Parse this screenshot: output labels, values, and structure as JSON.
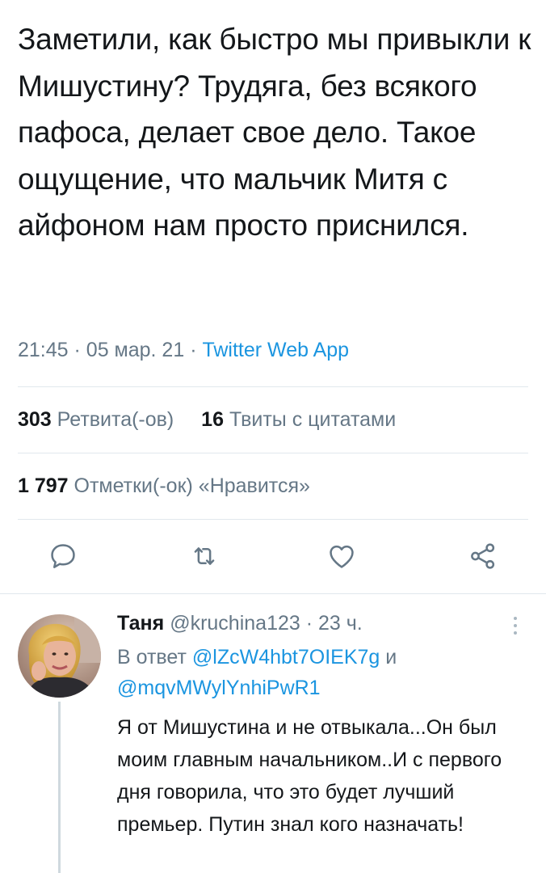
{
  "tweet": {
    "text": "Заметили, как быстро мы привыкли к Мишустину? Трудяга, без всякого пафоса, делает свое дело. Такое ощущение, что мальчик Митя с айфоном нам просто приснился.",
    "time": "21:45",
    "date": "05 мар. 21",
    "separator": "·",
    "source": "Twitter Web App"
  },
  "stats": {
    "retweets_count": "303",
    "retweets_label": "Ретвита(-ов)",
    "quotes_count": "16",
    "quotes_label": "Твиты с цитатами",
    "likes_count": "1 797",
    "likes_label": "Отметки(-ок) «Нравится»"
  },
  "actions": [
    "reply-icon",
    "retweet-icon",
    "heart-icon",
    "share-icon"
  ],
  "reply": {
    "name": "Таня",
    "handle": "@kruchina123",
    "separator": "·",
    "age": "23 ч.",
    "reply_prefix": "В ответ",
    "mention_1": "@lZcW4hbt7OIEK7g",
    "conjunction": "и",
    "mention_2": "@mqvMWylYnhiPwR1",
    "text": "Я от Мишустина и не отвыкала...Он был моим главным начальником..И с первого дня говорила, что это будет лучший премьер. Путин знал кого назначать!"
  },
  "colors": {
    "text": "#14171a",
    "secondary": "#657786",
    "link": "#1b95e0",
    "divider": "#e1e8ed"
  }
}
